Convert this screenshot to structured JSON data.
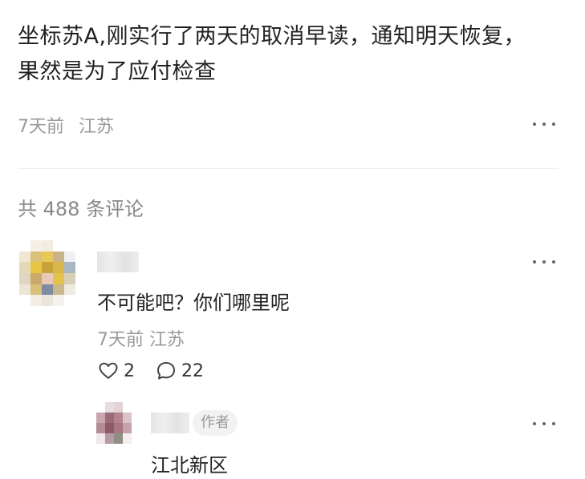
{
  "post": {
    "text": "坐标苏A,刚实行了两天的取消早读，通知明天恢复，果然是为了应付检查",
    "time": "7天前",
    "location": "江苏"
  },
  "comments_header": {
    "count_label": "共 488 条评论"
  },
  "comment": {
    "text": "不可能吧？你们哪里呢",
    "time": "7天前",
    "location": "江苏",
    "likes": "2",
    "replies": "22"
  },
  "reply": {
    "badge": "作者",
    "text": "江北新区"
  },
  "icons": {
    "more": "more-dots-icon",
    "like": "heart-outline-icon",
    "comment": "comment-bubble-icon"
  }
}
